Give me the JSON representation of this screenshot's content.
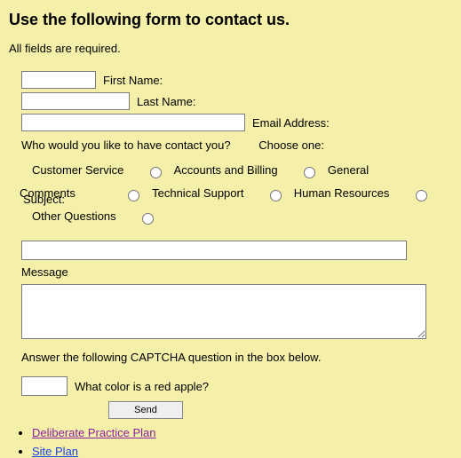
{
  "title": "Use the following form to contact us.",
  "required_notice": "All fields are required.",
  "fields": {
    "first_name_label": "First Name:",
    "last_name_label": "Last Name:",
    "email_label": "Email Address:"
  },
  "contact_question": "Who would you like to have contact you?",
  "choose_one": "Choose one:",
  "options": {
    "customer_service": "Customer Service",
    "accounts_billing": "Accounts and Billing",
    "general": "General",
    "comments": "Comments",
    "subject_inline": "Subject:",
    "technical_support": "Technical Support",
    "human_resources": "Human Resources",
    "other_questions": "Other Questions"
  },
  "message_label": "Message",
  "captcha_instruction": "Answer the following CAPTCHA question in the box below.",
  "captcha_question": "What color is a red apple?",
  "send_label": "Send",
  "links": {
    "deliberate": "Deliberate Practice Plan",
    "siteplan": "Site Plan"
  }
}
